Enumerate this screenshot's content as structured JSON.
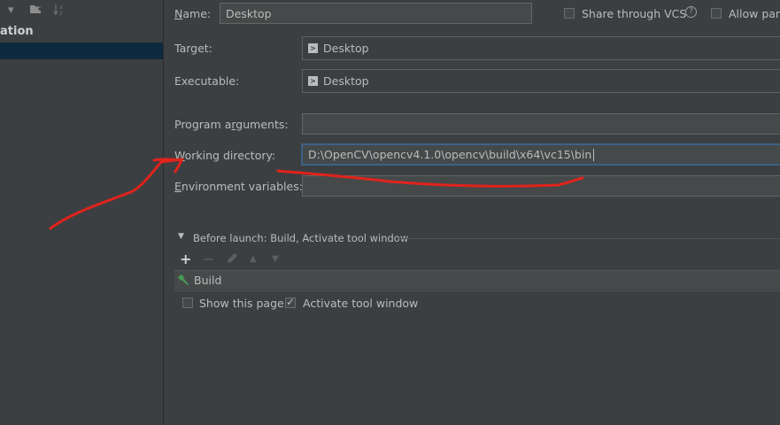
{
  "sidebar": {
    "tree_header": "ation"
  },
  "form": {
    "name_label": "Name:",
    "name_value": "Desktop",
    "share_label": "Share through VCS",
    "allow_label": "Allow para",
    "target_label": "Target:",
    "target_value": "Desktop",
    "executable_label": "Executable:",
    "executable_value": "Desktop",
    "program_args_label": "Program arguments:",
    "program_args_value": "",
    "working_dir_label": "Working directory:",
    "working_dir_value": "D:\\OpenCV\\opencv4.1.0\\opencv\\build\\x64\\vc15\\bin",
    "env_vars_label": "Environment variables:",
    "env_vars_value": ""
  },
  "before_launch": {
    "header": "Before launch: Build, Activate tool window",
    "tasks": [
      "Build"
    ],
    "show_page_label": "Show this page",
    "show_page_checked": false,
    "activate_label": "Activate tool window",
    "activate_checked": true
  },
  "colors": {
    "background": "#3c3f41",
    "selection": "#0d293e",
    "focus_border": "#3d6185",
    "annotation_red": "#e0231b"
  }
}
